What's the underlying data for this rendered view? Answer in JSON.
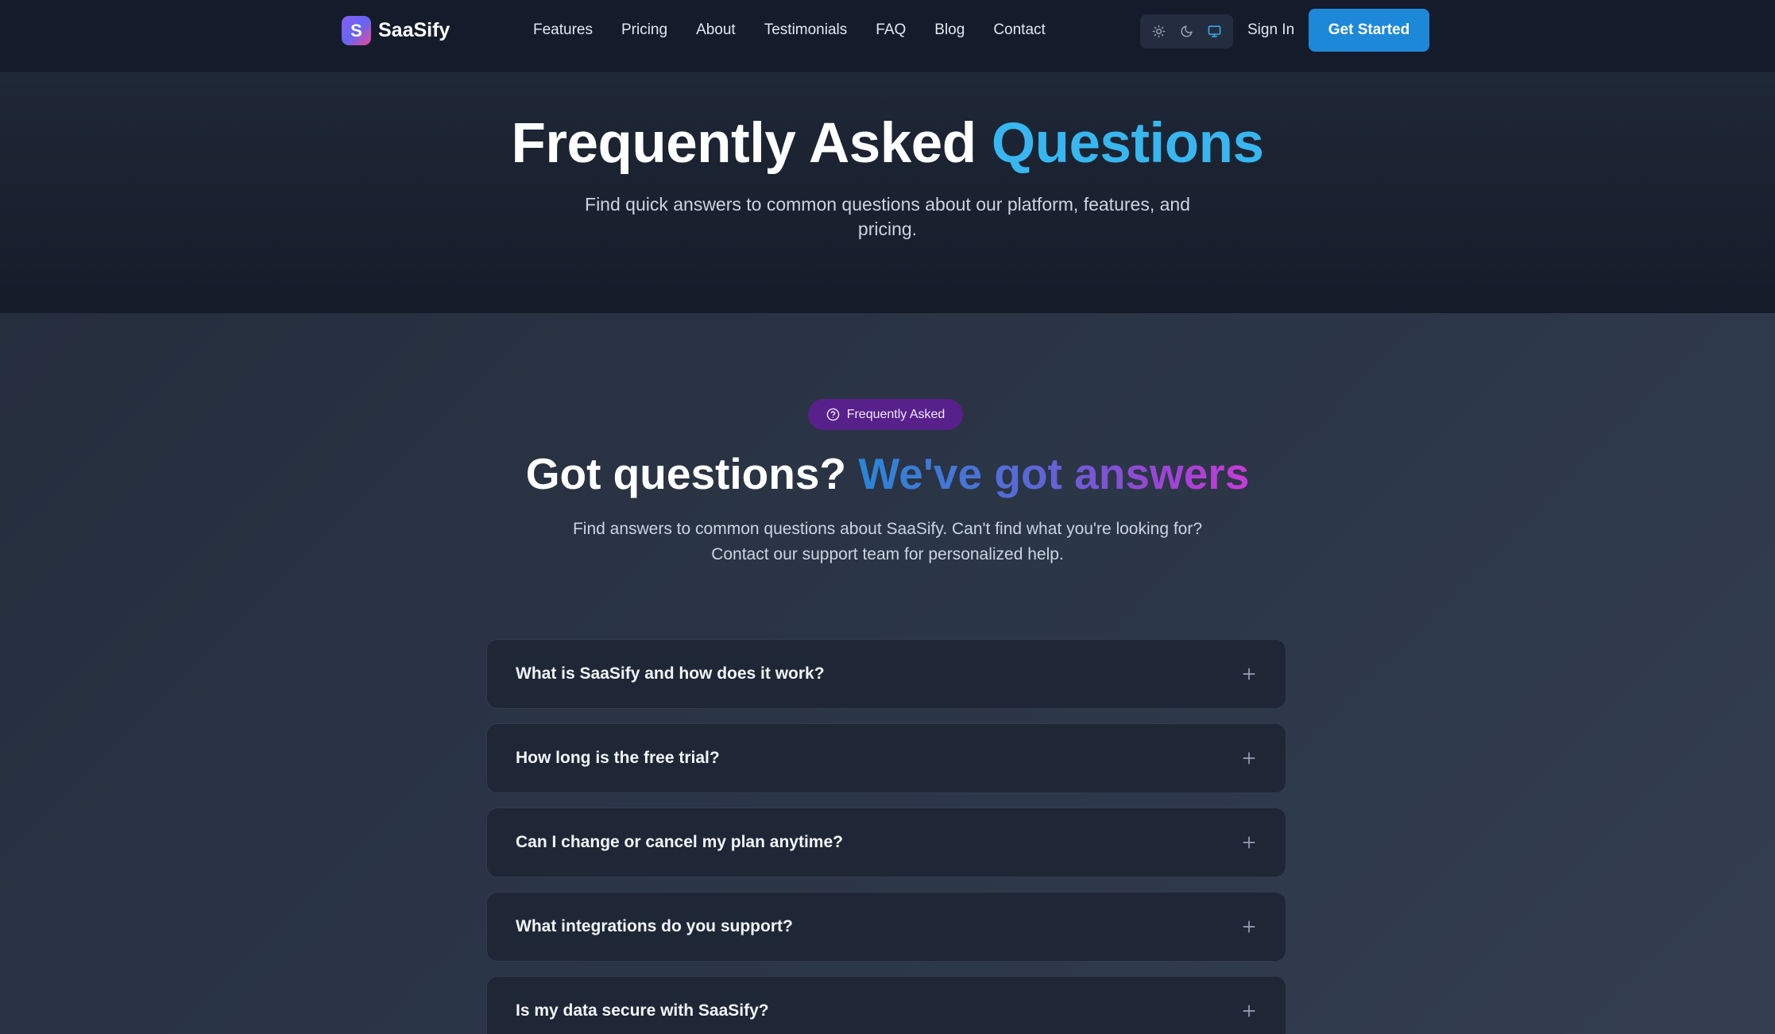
{
  "brand": {
    "logo_letter": "S",
    "name": "SaaSify"
  },
  "nav": {
    "links": [
      "Features",
      "Pricing",
      "About",
      "Testimonials",
      "FAQ",
      "Blog",
      "Contact"
    ],
    "theme_icons": [
      "sun-icon",
      "moon-icon",
      "monitor-icon"
    ],
    "sign_in": "Sign In",
    "cta": "Get Started"
  },
  "hero": {
    "title_main": "Frequently Asked",
    "title_accent": "Questions",
    "subtitle": "Find quick answers to common questions about our platform, features, and pricing."
  },
  "faq_section": {
    "pill_label": "Frequently Asked",
    "title_main": "Got questions?",
    "title_gradient": "We've got answers",
    "description_line1": "Find answers to common questions about SaaSify. Can't find what you're looking for?",
    "description_line2": "Contact our support team for personalized help.",
    "questions": [
      "What is SaaSify and how does it work?",
      "How long is the free trial?",
      "Can I change or cancel my plan anytime?",
      "What integrations do you support?",
      "Is my data secure with SaaSify?"
    ]
  },
  "colors": {
    "accent": "#38b6f0",
    "cta": "#1e88d8",
    "pill_bg": "#58208a",
    "nav_bg": "#141b2b"
  }
}
